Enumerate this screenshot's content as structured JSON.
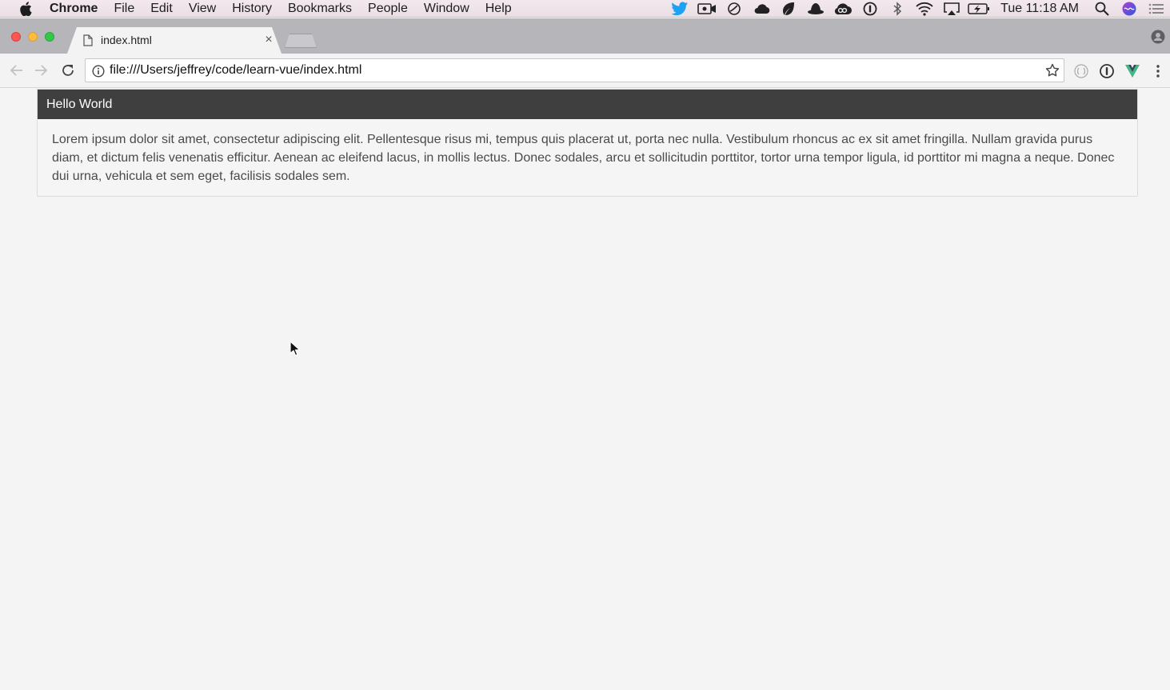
{
  "menubar": {
    "app_name": "Chrome",
    "items": [
      "File",
      "Edit",
      "View",
      "History",
      "Bookmarks",
      "People",
      "Window",
      "Help"
    ],
    "clock": "Tue 11:18 AM",
    "status_icons": [
      "twitter-icon",
      "screen-record-icon",
      "sync-icon",
      "cloud-icon",
      "leaf-icon",
      "alfred-hat-icon",
      "creative-cloud-icon",
      "1password-icon",
      "bluetooth-icon",
      "wifi-icon",
      "airplay-icon",
      "battery-charging-icon",
      "spotlight-icon",
      "siri-icon",
      "notification-center-icon"
    ]
  },
  "browser": {
    "tab": {
      "title": "index.html",
      "close_glyph": "×"
    },
    "address_bar": {
      "url": "file:///Users/jeffrey/code/learn-vue/index.html"
    },
    "extensions": [
      "extension-circle-icon",
      "1password-extension-icon",
      "vue-devtools-icon",
      "menu-icon"
    ]
  },
  "page": {
    "card": {
      "title": "Hello World",
      "body": "Lorem ipsum dolor sit amet, consectetur adipiscing elit. Pellentesque risus mi, tempus quis placerat ut, porta nec nulla. Vestibulum rhoncus ac ex sit amet fringilla. Nullam gravida purus diam, et dictum felis venenatis efficitur. Aenean ac eleifend lacus, in mollis lectus. Donec sodales, arcu et sollicitudin porttitor, tortor urna tempor ligula, id porttitor mi magna a neque. Donec dui urna, vehicula et sem eget, facilisis sodales sem."
    }
  },
  "colors": {
    "card_header_bg": "#3f3f3f",
    "card_header_text": "#ffffff",
    "body_text": "#4a4a4a",
    "page_bg": "#f4f4f4",
    "vue_green": "#41b883"
  }
}
